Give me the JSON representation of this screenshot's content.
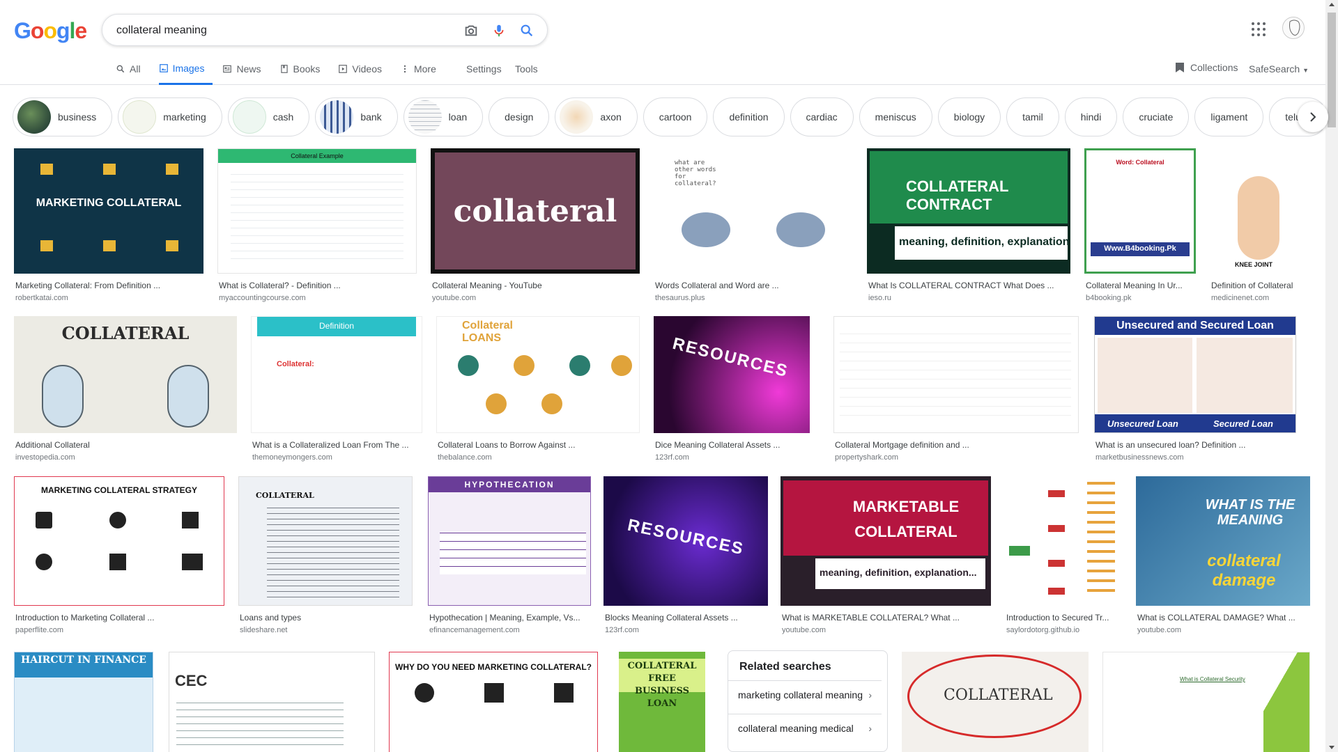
{
  "search": {
    "query": "collateral meaning"
  },
  "logo": {
    "letters": [
      "G",
      "o",
      "o",
      "g",
      "l",
      "e"
    ]
  },
  "tabs": [
    {
      "label": "All",
      "icon": "search-icon"
    },
    {
      "label": "Images",
      "icon": "image-icon",
      "active": true
    },
    {
      "label": "News",
      "icon": "news-icon"
    },
    {
      "label": "Books",
      "icon": "book-icon"
    },
    {
      "label": "Videos",
      "icon": "video-icon"
    },
    {
      "label": "More",
      "icon": "more-vert-icon"
    }
  ],
  "tools": {
    "settings": "Settings",
    "tools": "Tools",
    "collections": "Collections",
    "safesearch": "SafeSearch"
  },
  "chips": [
    {
      "label": "business",
      "thumb": true
    },
    {
      "label": "marketing",
      "thumb": true
    },
    {
      "label": "cash",
      "thumb": true
    },
    {
      "label": "bank",
      "thumb": true
    },
    {
      "label": "loan",
      "thumb": true
    },
    {
      "label": "design",
      "thumb": false
    },
    {
      "label": "axon",
      "thumb": true
    },
    {
      "label": "cartoon",
      "thumb": false
    },
    {
      "label": "definition",
      "thumb": false
    },
    {
      "label": "cardiac",
      "thumb": false
    },
    {
      "label": "meniscus",
      "thumb": false
    },
    {
      "label": "biology",
      "thumb": false
    },
    {
      "label": "tamil",
      "thumb": false
    },
    {
      "label": "hindi",
      "thumb": false
    },
    {
      "label": "cruciate",
      "thumb": false
    },
    {
      "label": "ligament",
      "thumb": false
    },
    {
      "label": "telugu",
      "thumb": false
    }
  ],
  "row1": [
    {
      "title": "Marketing Collateral: From Definition ...",
      "src": "robertkatai.com",
      "img_text": "MARKETING COLLATERAL"
    },
    {
      "title": "What is Collateral? - Definition ...",
      "src": "myaccountingcourse.com",
      "img_text": "Collateral Example"
    },
    {
      "title": "Collateral Meaning - YouTube",
      "src": "youtube.com",
      "img_text": "collateral"
    },
    {
      "title": "Words Collateral and Word are ...",
      "src": "thesaurus.plus",
      "img_text": "what are other words for collateral?"
    },
    {
      "title": "What Is COLLATERAL CONTRACT What Does ...",
      "src": "ieso.ru",
      "img_text": "COLLATERAL CONTRACT",
      "img_sub": "meaning, definition, explanation"
    },
    {
      "title": "Collateral Meaning In Ur...",
      "src": "b4booking.pk",
      "img_text": "Word: Collateral",
      "img_sub": "Www.B4booking.Pk"
    },
    {
      "title": "Definition of Collateral",
      "src": "medicinenet.com",
      "img_text": "KNEE JOINT"
    }
  ],
  "row2": [
    {
      "title": "Additional Collateral",
      "src": "investopedia.com",
      "img_text": "COLLATERAL"
    },
    {
      "title": "What is a Collateralized Loan From The ...",
      "src": "themoneymongers.com",
      "img_text": "Definition",
      "img_sub": "Collateral:"
    },
    {
      "title": "Collateral Loans to Borrow Against ...",
      "src": "thebalance.com",
      "img_text": "Collateral LOANS"
    },
    {
      "title": "Dice Meaning Collateral Assets ...",
      "src": "123rf.com",
      "img_text": "RESOURCES"
    },
    {
      "title": "Collateral Mortgage definition and ...",
      "src": "propertyshark.com",
      "img_text": ""
    },
    {
      "title": "What is an unsecured loan? Definition ...",
      "src": "marketbusinessnews.com",
      "img_text": "Unsecured and Secured Loan",
      "img_sub": "Unsecured Loan",
      "img_sub2": "Secured Loan"
    }
  ],
  "row3": [
    {
      "title": "Introduction to Marketing Collateral ...",
      "src": "paperflite.com",
      "img_text": "MARKETING COLLATERAL STRATEGY"
    },
    {
      "title": "Loans and types",
      "src": "slideshare.net",
      "img_text": "COLLATERAL"
    },
    {
      "title": "Hypothecation | Meaning, Example, Vs...",
      "src": "efinancemanagement.com",
      "img_text": "HYPOTHECATION"
    },
    {
      "title": "Blocks Meaning Collateral Assets ...",
      "src": "123rf.com",
      "img_text": "RESOURCES"
    },
    {
      "title": "What is MARKETABLE COLLATERAL? What ...",
      "src": "youtube.com",
      "img_text": "MARKETABLE COLLATERAL",
      "img_sub": "meaning, definition, explanation..."
    },
    {
      "title": "Introduction to Secured Tr...",
      "src": "saylordotorg.github.io",
      "img_text": ""
    },
    {
      "title": "What is COLLATERAL DAMAGE? What ...",
      "src": "youtube.com",
      "img_text": "WHAT IS THE MEANING",
      "img_sub": "collateral damage"
    }
  ],
  "row4": [
    {
      "img_text": "HAIRCUT IN FINANCE"
    },
    {
      "img_text": "CEC"
    },
    {
      "img_text": "WHY DO YOU NEED MARKETING COLLATERAL?"
    },
    {
      "img_text": "COLLATERAL FREE BUSINESS LOAN"
    },
    {
      "img_text": "COLLATERAL"
    },
    {
      "img_text": "What is Collateral Security"
    }
  ],
  "related": {
    "title": "Related searches",
    "items": [
      "marketing collateral meaning",
      "collateral meaning medical"
    ]
  },
  "colors": {
    "accent": "#1a73e8",
    "text": "#202124",
    "muted": "#70757a"
  }
}
